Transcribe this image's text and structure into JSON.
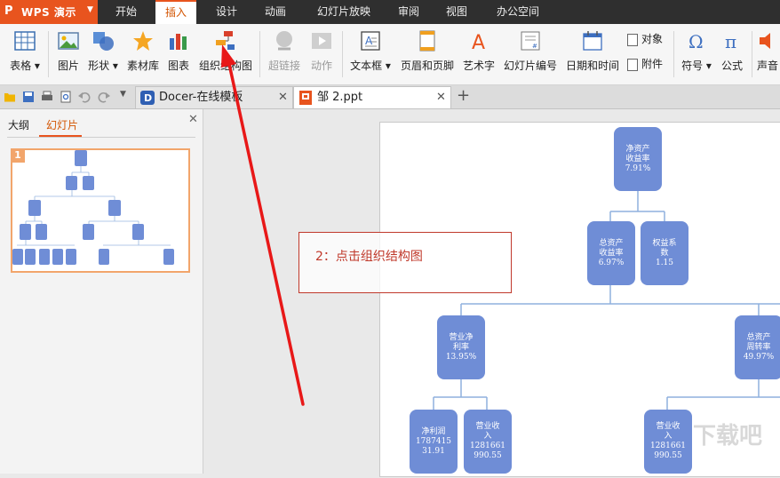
{
  "app": {
    "name": "WPS 演示",
    "logo_letter": "P"
  },
  "menu": {
    "items": [
      {
        "label": "开始",
        "active": false
      },
      {
        "label": "插入",
        "active": true
      },
      {
        "label": "设计",
        "active": false
      },
      {
        "label": "动画",
        "active": false
      },
      {
        "label": "幻灯片放映",
        "active": false
      },
      {
        "label": "审阅",
        "active": false
      },
      {
        "label": "视图",
        "active": false
      },
      {
        "label": "办公空间",
        "active": false
      }
    ]
  },
  "ribbon": {
    "table": "表格",
    "picture": "图片",
    "shapes": "形状",
    "material": "素材库",
    "chart": "图表",
    "org_chart": "组织结构图",
    "hyperlink": "超链接",
    "action": "动作",
    "textbox": "文本框",
    "header_footer": "页眉和页脚",
    "wordart": "艺术字",
    "slide_number": "幻灯片编号",
    "date_time": "日期和时间",
    "object": "对象",
    "attachment": "附件",
    "symbol": "符号",
    "formula": "公式",
    "sound": "声音"
  },
  "tabs": [
    {
      "label": "Docer-在线模板",
      "active": false
    },
    {
      "label": "邹 2.ppt",
      "active": true
    }
  ],
  "panel": {
    "tab_outline": "大纲",
    "tab_slides": "幻灯片",
    "slide_number": "1"
  },
  "org_nodes": {
    "n1": "净资产\n收益率\n7.91%",
    "n2": "总资产\n收益率\n6.97%",
    "n3": "权益系\n数\n1.15",
    "n4": "营业净\n利率\n13.95%",
    "n5": "总资产\n周转率\n49.97%",
    "n6": "净利润\n1787415\n31.91",
    "n7": "营业收\n入\n1281661\n990.55",
    "n8": "营业收\n入\n1281661\n990.55"
  },
  "annotation": {
    "text": "2：点击组织结构图"
  },
  "watermark": "下载吧",
  "colors": {
    "accent": "#e8541e",
    "node": "#6f8dd6",
    "connector": "#8fb0de",
    "arrow": "#e81818"
  }
}
